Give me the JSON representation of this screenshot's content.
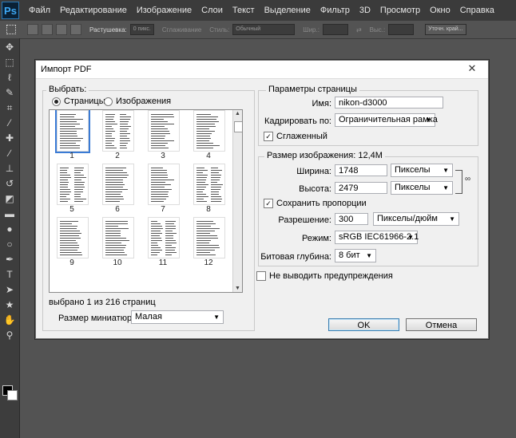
{
  "app": {
    "logo": "Ps"
  },
  "menu": [
    "Файл",
    "Редактирование",
    "Изображение",
    "Слои",
    "Текст",
    "Выделение",
    "Фильтр",
    "3D",
    "Просмотр",
    "Окно",
    "Справка"
  ],
  "options_bar": {
    "feather_label": "Растушевка:",
    "feather_value": "0 пикс.",
    "antialias_label": "Сглаживание",
    "style_label": "Стиль:",
    "style_value": "Обычный",
    "width_label": "Шир.:",
    "height_label": "Выс.:",
    "refine_label": "Уточн. край..."
  },
  "dialog": {
    "title": "Импорт PDF",
    "select_group": {
      "title": "Выбрать:",
      "radio_pages": "Страницы",
      "radio_images": "Изображения",
      "pages": [
        "1",
        "2",
        "3",
        "4",
        "5",
        "6",
        "7",
        "8",
        "9",
        "10",
        "11",
        "12"
      ],
      "selection_status": "выбрано 1 из 216 страниц",
      "thumb_size_label": "Размер миниатюры:",
      "thumb_size_value": "Малая"
    },
    "page_options": {
      "title": "Параметры страницы",
      "name_label": "Имя:",
      "name_value": "nikon-d3000",
      "crop_label": "Кадрировать по:",
      "crop_value": "Ограничительная рамка",
      "antialias_label": "Сглаженный"
    },
    "image_size": {
      "title": "Размер изображения: 12,4M",
      "width_label": "Ширина:",
      "width_value": "1748",
      "width_unit": "Пикселы",
      "height_label": "Высота:",
      "height_value": "2479",
      "height_unit": "Пикселы",
      "constrain_label": "Сохранить пропорции",
      "resolution_label": "Разрешение:",
      "resolution_value": "300",
      "resolution_unit": "Пикселы/дюйм",
      "mode_label": "Режим:",
      "mode_value": "sRGB IEC61966-2.1",
      "depth_label": "Битовая глубина:",
      "depth_value": "8 бит"
    },
    "suppress_warnings_label": "Не выводить предупреждения",
    "ok_label": "OK",
    "cancel_label": "Отмена"
  }
}
